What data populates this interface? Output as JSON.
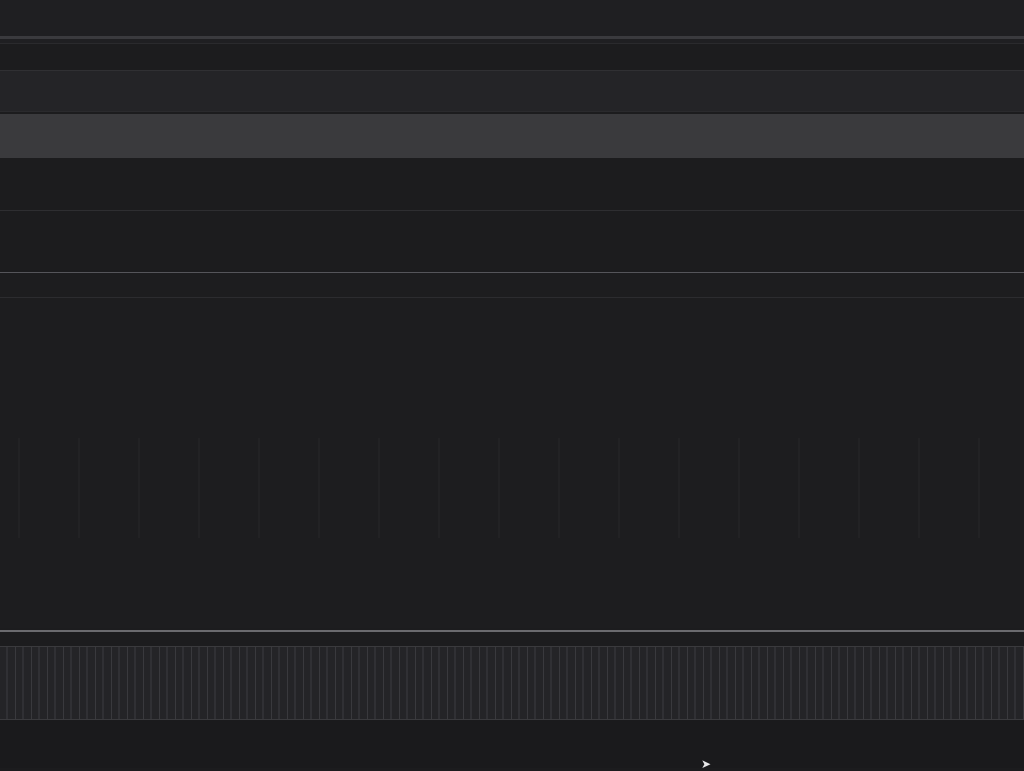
{
  "top_strip": {
    "text": ""
  },
  "header_band": {
    "text": ""
  },
  "info_band": {
    "text": ""
  },
  "dots_row": {
    "text": ""
  },
  "second_row": {
    "text": ""
  },
  "list": {
    "header": "",
    "rows": [
      {
        "text": ""
      },
      {
        "text": ""
      },
      {
        "text": ""
      },
      {
        "text": ""
      },
      {
        "text": ""
      }
    ]
  },
  "bottom_strip": {
    "slots": [
      "",
      "",
      "",
      "",
      "",
      "",
      "",
      ""
    ]
  },
  "cursor": {
    "glyph": "➤"
  }
}
